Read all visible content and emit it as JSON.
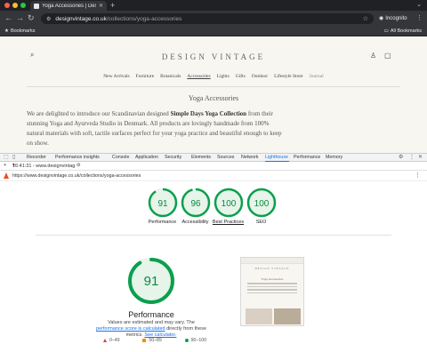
{
  "browser": {
    "tab_title": "Yoga Accessories | Design V",
    "url_host": "designvintage.co.uk",
    "url_path": "/collections/yoga-accessories",
    "profile_label": "Incognito",
    "bookmarks_label": "Bookmarks",
    "all_bookmarks_label": "All Bookmarks"
  },
  "site": {
    "logo": "DESIGN VINTAGE",
    "nav": [
      "New Arrivals",
      "Furniture",
      "Botanicals",
      "Accessories",
      "Lights",
      "Gifts",
      "Outdoor",
      "Lifestyle Store",
      "Journal"
    ],
    "active_nav": "Accessories",
    "page_title": "Yoga Accessories",
    "intro_before": "We are delighted to introduce our Scandinavian designed ",
    "intro_bold": "Simple Days Yoga Collection",
    "intro_after": " from their stunning Yoga and Ayurveda Studio in Denmark. All products are lovingly handmade from 100% natural materials with soft, tactile surfaces perfect for your yoga practice and beautiful enough to keep on show."
  },
  "devtools": {
    "tabs": [
      "Recorder",
      "Performance insights",
      "Console",
      "Application",
      "Security",
      "Elements",
      "Sources",
      "Network",
      "Lighthouse",
      "Performance",
      "Memory"
    ],
    "active_tab": "Lighthouse",
    "report_time": "16:41:31 - www.designvintag",
    "report_url": "https://www.designvintage.co.uk/collections/yoga-accessories"
  },
  "lighthouse": {
    "scores": [
      {
        "label": "Performance",
        "value": 91
      },
      {
        "label": "Accessibility",
        "value": 96
      },
      {
        "label": "Best Practices",
        "value": 100
      },
      {
        "label": "SEO",
        "value": 100
      }
    ],
    "performance_score": 91,
    "performance_title": "Performance",
    "note_prefix": "Values are estimated and may vary. The ",
    "note_link1": "performance score is calculated",
    "note_middle": " directly from these metrics. ",
    "note_link2": "See calculator.",
    "legend": [
      {
        "range": "0–49",
        "color": "#e53935"
      },
      {
        "range": "50–89",
        "color": "#fb8c00"
      },
      {
        "range": "90–100",
        "color": "#0c9f4c"
      }
    ],
    "thumb_logo": "DESIGN VINTAGE",
    "thumb_title": "Yoga Accessories"
  },
  "colors": {
    "pass": "#0c9f4c",
    "pass_fill": "#e6f4ea",
    "link": "#1a73e8"
  }
}
